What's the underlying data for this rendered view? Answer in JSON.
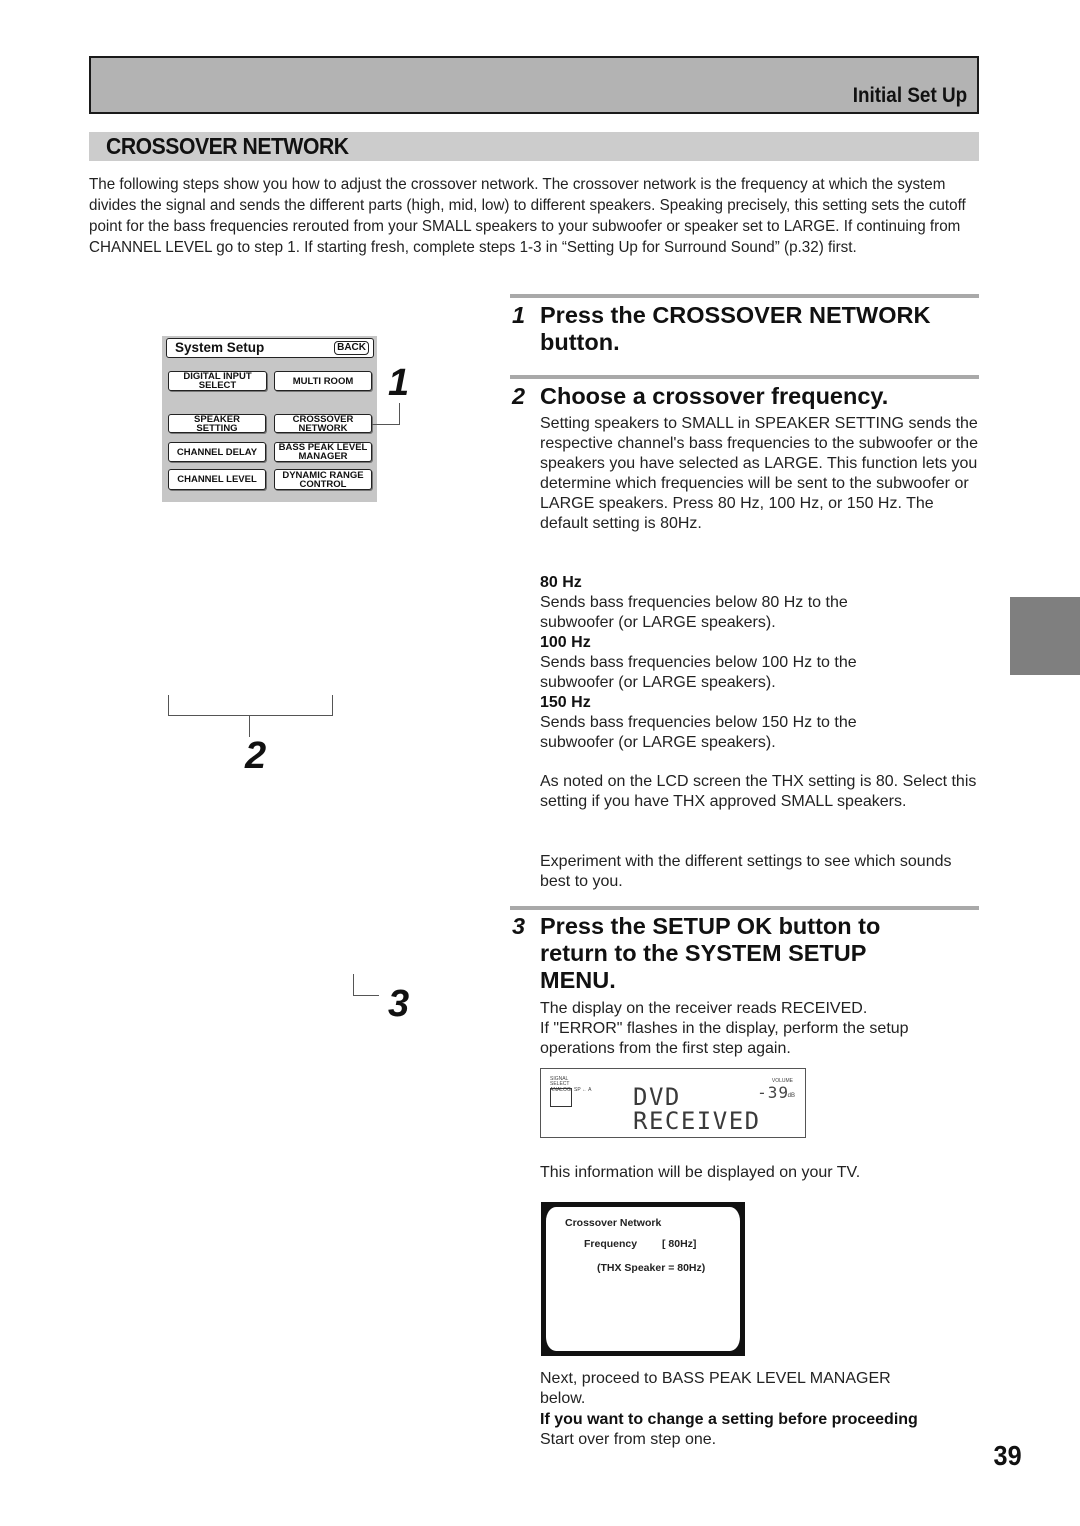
{
  "header": {
    "section_label": "Initial Set Up",
    "title": "CROSSOVER NETWORK"
  },
  "intro": "The following steps show you how to adjust the crossover network. The crossover network is the frequency at which the system divides the signal and sends the different parts (high, mid, low) to different speakers. Speaking precisely, this setting sets the cutoff point for the bass frequencies rerouted from your SMALL speakers to your subwoofer or speaker set to LARGE. If continuing from CHANNEL LEVEL go to step 1. If starting fresh, complete steps 1-3 in “Setting Up for Surround Sound” (p.32) first.",
  "system_setup_panel": {
    "title": "System Setup",
    "back_label": "BACK",
    "buttons": [
      {
        "line1": "DIGITAL INPUT",
        "line2": "SELECT"
      },
      {
        "line1": "MULTI ROOM",
        "line2": ""
      },
      {
        "line1": "SPEAKER",
        "line2": "SETTING"
      },
      {
        "line1": "CROSSOVER",
        "line2": "NETWORK"
      },
      {
        "line1": "CHANNEL DELAY",
        "line2": ""
      },
      {
        "line1": "BASS PEAK LEVEL",
        "line2": "MANAGER"
      },
      {
        "line1": "CHANNEL LEVEL",
        "line2": ""
      },
      {
        "line1": "DYNAMIC RANGE",
        "line2": "CONTROL"
      }
    ]
  },
  "callouts": [
    "1",
    "2",
    "3"
  ],
  "steps": [
    {
      "number": "1",
      "heading": "Press the CROSSOVER NETWORK button."
    },
    {
      "number": "2",
      "heading": "Choose a crossover frequency.",
      "body": "Setting speakers to SMALL in SPEAKER SETTING sends the respective channel's bass frequencies to the subwoofer or the speakers you have selected as LARGE. This function lets you determine which frequencies will be sent to the subwoofer or LARGE speakers. Press 80 Hz, 100 Hz, or 150 Hz. The default setting is 80Hz.",
      "options": [
        {
          "label": "80 Hz",
          "desc": "Sends bass frequencies below 80 Hz to the subwoofer (or LARGE speakers)."
        },
        {
          "label": "100 Hz",
          "desc": "Sends bass frequencies below 100 Hz to the subwoofer (or LARGE speakers)."
        },
        {
          "label": "150 Hz",
          "desc": "Sends bass frequencies below 150 Hz to the subwoofer (or LARGE speakers)."
        }
      ],
      "note_thx": "As noted on the LCD screen the THX setting is 80. Select this setting if you have THX approved SMALL speakers.",
      "note_experiment": "Experiment with the different settings to see which sounds best to you."
    },
    {
      "number": "3",
      "heading": "Press the SETUP OK button to return to the SYSTEM SETUP MENU.",
      "body1": "The display on the receiver reads RECEIVED.",
      "body2": "If \"ERROR\" flashes in the display, perform the setup operations from the first step again."
    }
  ],
  "lcd_display": {
    "signal_select_label": "SIGNAL SELECT",
    "analog_label": "ANALOG",
    "sp_label": "SP ← A",
    "volume_label": "VOLUME",
    "volume_value": "-39",
    "volume_unit": "dB",
    "line1": "DVD",
    "line2": "RECEIVED"
  },
  "tv_caption": "This information will be displayed on your TV.",
  "tv_screen": {
    "title": "Crossover Network",
    "frequency_label": "Frequency",
    "frequency_value": "[ 80Hz]",
    "thx_note": "(THX Speaker = 80Hz)"
  },
  "footer": {
    "next": "Next, proceed to BASS PEAK LEVEL MANAGER below.",
    "change_heading": "If you want to change a setting before proceeding",
    "change_body": "Start over from step one."
  },
  "page_number": "39",
  "colors": {
    "banner": "#b3b3b3",
    "title_bar": "#cccccc",
    "rule": "#a9a9a9",
    "side_tab": "#7f7f7f",
    "panel": "#c6c6c6"
  }
}
